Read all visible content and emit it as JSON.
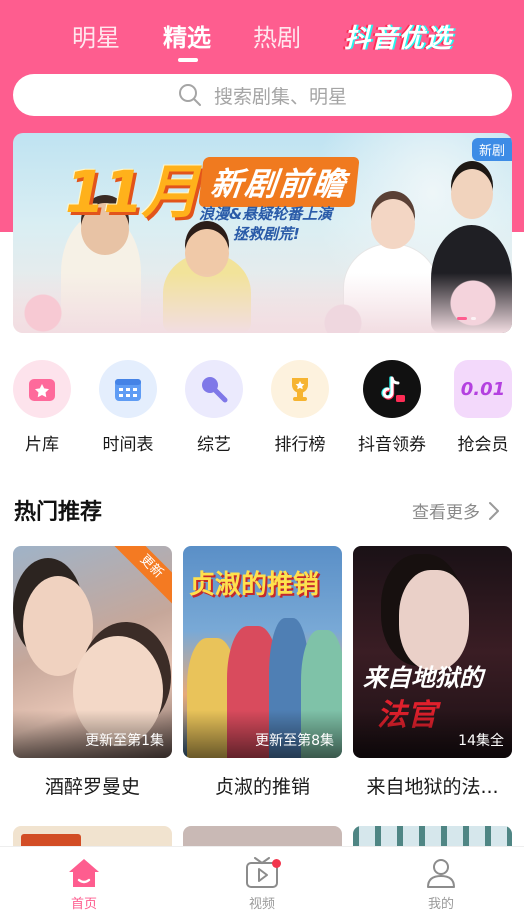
{
  "header": {
    "tabs": [
      {
        "label": "明星",
        "active": false
      },
      {
        "label": "精选",
        "active": true
      },
      {
        "label": "热剧",
        "active": false
      }
    ],
    "brand_tab": "抖音优选",
    "accent_color": "#fe5d8f"
  },
  "search": {
    "placeholder": "搜索剧集、明星"
  },
  "banner": {
    "headline_number": "11月",
    "headline_title": "新剧前瞻",
    "subtitle_line1": "浪漫&悬疑轮番上演",
    "subtitle_line2": "拯救剧荒!",
    "badge": "新剧"
  },
  "quick_menu": [
    {
      "label": "片库",
      "icon": "folder-star-icon"
    },
    {
      "label": "时间表",
      "icon": "calendar-icon"
    },
    {
      "label": "综艺",
      "icon": "microphone-icon"
    },
    {
      "label": "排行榜",
      "icon": "trophy-icon"
    },
    {
      "label": "抖音领券",
      "icon": "douyin-coupon-icon"
    },
    {
      "label": "抢会员",
      "icon": "vip-coin-icon"
    }
  ],
  "vip_coin_text": "0.01",
  "hot_section": {
    "title": "热门推荐",
    "see_more": "查看更多"
  },
  "cards": [
    {
      "title": "酒醉罗曼史",
      "episode": "更新至第1集",
      "ribbon": "更新"
    },
    {
      "title": "贞淑的推销",
      "episode": "更新至第8集",
      "poster_text": "贞淑的推销"
    },
    {
      "title": "来自地狱的法...",
      "episode": "14集全",
      "poster_text_1": "来自地狱的",
      "poster_text_2": "法官"
    }
  ],
  "bottom_nav": [
    {
      "label": "首页",
      "icon": "home-icon",
      "active": true
    },
    {
      "label": "视频",
      "icon": "tv-play-icon",
      "active": false
    },
    {
      "label": "我的",
      "icon": "user-icon",
      "active": false
    }
  ]
}
